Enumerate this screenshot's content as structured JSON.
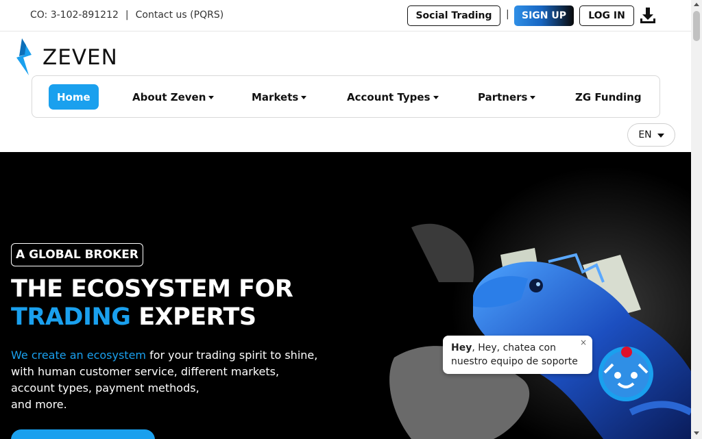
{
  "topbar": {
    "company_code": "CO: 3-102-891212",
    "separator": "|",
    "contact_link": "Contact us (PQRS)",
    "social_trading": "Social Trading",
    "pipe": "|",
    "sign_up": "SIGN UP",
    "log_in": "LOG IN",
    "download_icon": "download-icon"
  },
  "logo": {
    "text": "ZEVEN"
  },
  "nav": {
    "items": [
      {
        "label": "Home",
        "active": true,
        "dropdown": false
      },
      {
        "label": "About Zeven",
        "dropdown": true
      },
      {
        "label": "Markets",
        "dropdown": true
      },
      {
        "label": "Account Types",
        "dropdown": true
      },
      {
        "label": "Partners",
        "dropdown": true
      },
      {
        "label": "ZG Funding",
        "dropdown": false
      }
    ]
  },
  "language": {
    "selected": "EN"
  },
  "hero": {
    "badge": "A GLOBAL BROKER",
    "headline_line1": "THE ECOSYSTEM FOR",
    "headline_highlight": "TRADING",
    "headline_rest": " EXPERTS",
    "para_highlight": "We create an ecosystem",
    "para_line1_rest": " for your trading spirit to shine,",
    "para_line2": "with human customer service, different markets,",
    "para_line3": "account types, payment methods,",
    "para_line4": "and more."
  },
  "chat": {
    "bold": "Hey",
    "message_rest": ", Hey, chatea con nuestro equipo de soporte",
    "close": "×"
  },
  "colors": {
    "accent": "#1aa0ee",
    "hero_bg": "#000000",
    "signup_gradient_start": "#2f8fe6",
    "signup_gradient_end": "#0a0a0a"
  }
}
